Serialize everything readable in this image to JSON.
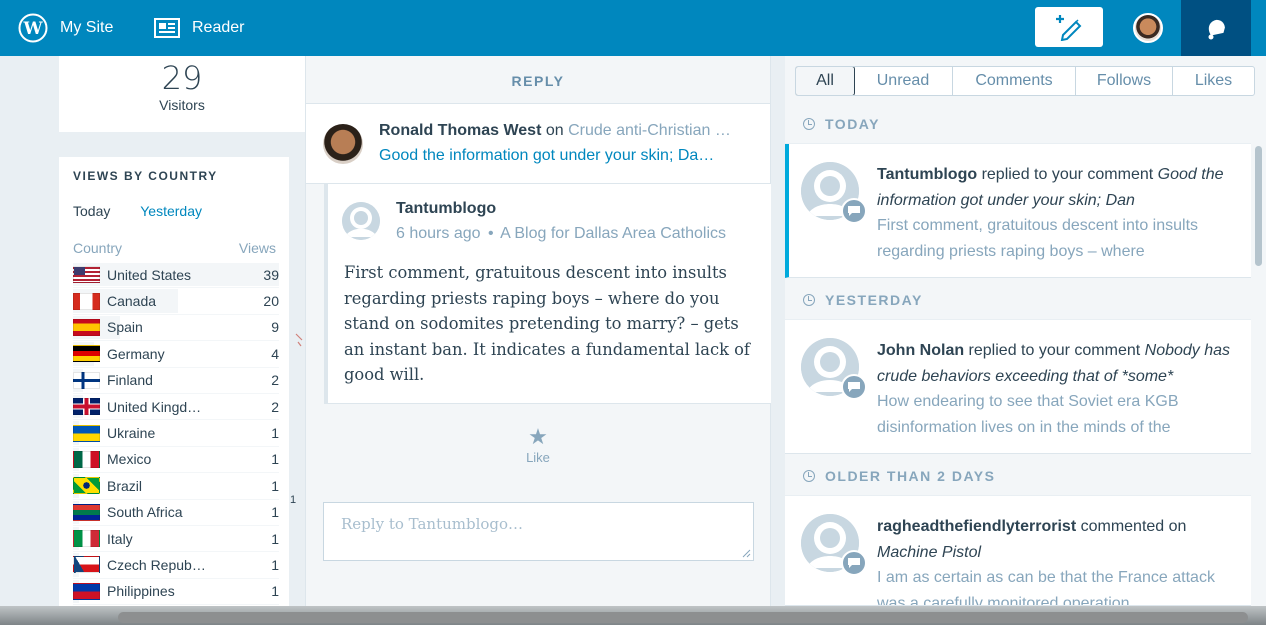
{
  "masterbar": {
    "my_site": "My Site",
    "reader": "Reader"
  },
  "stats": {
    "visitors_value": "29",
    "visitors_label": "Visitors",
    "views_by_country": {
      "title": "VIEWS BY COUNTRY",
      "tabs": [
        "Today",
        "Yesterday"
      ],
      "col_country": "Country",
      "col_views": "Views",
      "rows": [
        {
          "country": "United States",
          "views": "39",
          "flag": "us",
          "fill": 1.0
        },
        {
          "country": "Canada",
          "views": "20",
          "flag": "ca",
          "fill": 0.51
        },
        {
          "country": "Spain",
          "views": "9",
          "flag": "es",
          "fill": 0.23
        },
        {
          "country": "Germany",
          "views": "4",
          "flag": "de",
          "fill": 0.1
        },
        {
          "country": "Finland",
          "views": "2",
          "flag": "fi",
          "fill": 0.05
        },
        {
          "country": "United Kingd…",
          "views": "2",
          "flag": "gb",
          "fill": 0.05
        },
        {
          "country": "Ukraine",
          "views": "1",
          "flag": "ua",
          "fill": 0.03
        },
        {
          "country": "Mexico",
          "views": "1",
          "flag": "mx",
          "fill": 0.03
        },
        {
          "country": "Brazil",
          "views": "1",
          "flag": "br",
          "fill": 0.03
        },
        {
          "country": "South Africa",
          "views": "1",
          "flag": "za",
          "fill": 0.03
        },
        {
          "country": "Italy",
          "views": "1",
          "flag": "it",
          "fill": 0.03
        },
        {
          "country": "Czech Repub…",
          "views": "1",
          "flag": "cz",
          "fill": 0.03
        },
        {
          "country": "Philippines",
          "views": "1",
          "flag": "ph",
          "fill": 0.03
        }
      ]
    }
  },
  "reply_panel": {
    "header": "REPLY",
    "post_author": "Ronald Thomas West",
    "post_on": "on",
    "post_title": "Crude anti-Christian …",
    "post_excerpt": "Good the information got under your skin; Da…",
    "comment_author": "Tantumblogo",
    "comment_time": "6 hours ago",
    "comment_dot": "•",
    "comment_site": "A Blog for Dallas Area Catholics",
    "comment_body": "First comment, gratuitous descent into insults regarding priests raping boys – where do you stand on sodomites pretending to marry? – gets an instant ban. It indicates a fundamental lack of good will.",
    "like_label": "Like",
    "reply_placeholder": "Reply to Tantumblogo…"
  },
  "notifications": {
    "filters": [
      "All",
      "Unread",
      "Comments",
      "Follows",
      "Likes"
    ],
    "groups": [
      {
        "title": "TODAY",
        "items": [
          {
            "actor": "Tantumblogo",
            "action": " replied to your comment ",
            "target": "Good the information got under your skin; Dan",
            "excerpt": "First comment, gratuitous descent into insults regarding priests raping boys – where",
            "unread": true
          }
        ]
      },
      {
        "title": "YESTERDAY",
        "items": [
          {
            "actor": "John Nolan",
            "action": " replied to your comment ",
            "target": "Nobody has crude behaviors exceeding that of *some*",
            "excerpt": "How endearing to see that Soviet era KGB disinformation lives on in the minds of the",
            "unread": false
          }
        ]
      },
      {
        "title": "OLDER THAN 2 DAYS",
        "items": [
          {
            "actor": "ragheadthefiendlyterrorist",
            "action": " commented on ",
            "target": "Machine Pistol",
            "excerpt": "I am as certain as can be that the France attack was a carefully monitored operation.",
            "unread": false
          }
        ]
      }
    ]
  },
  "fragments": {
    "stray_number": "1"
  },
  "colors": {
    "masterbar": "#0087be",
    "masterbar_active": "#005082",
    "link": "#0087be",
    "muted": "#87a6bc",
    "unread_accent": "#00aadc",
    "text": "#2e4453"
  }
}
